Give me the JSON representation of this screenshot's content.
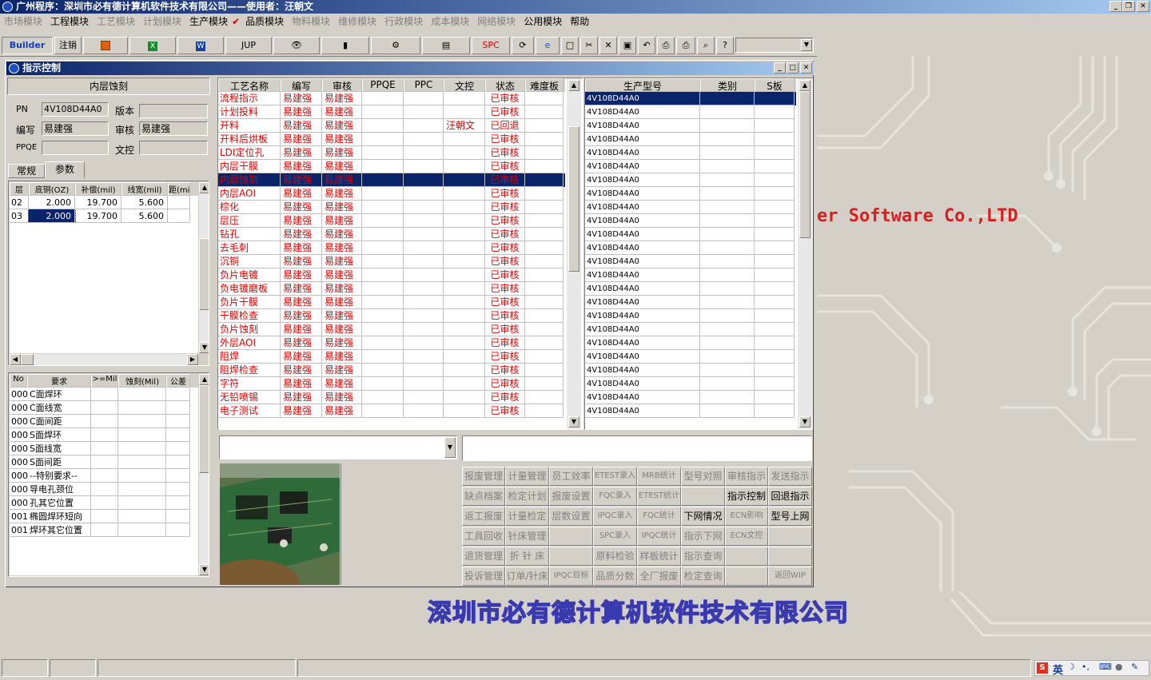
{
  "app": {
    "title": "广州程序：深圳市必有德计算机软件技术有限公司——使用者：汪朝文"
  },
  "menu": [
    {
      "label": "市场模块",
      "enabled": false
    },
    {
      "label": "工程模块",
      "enabled": true
    },
    {
      "label": "工艺模块",
      "enabled": false
    },
    {
      "label": "计划模块",
      "enabled": false
    },
    {
      "label": "生产模块",
      "enabled": true
    },
    {
      "label": "品质模块",
      "enabled": true
    },
    {
      "label": "物料模块",
      "enabled": false
    },
    {
      "label": "维修模块",
      "enabled": false
    },
    {
      "label": "行政模块",
      "enabled": false
    },
    {
      "label": "成本模块",
      "enabled": false
    },
    {
      "label": "网络模块",
      "enabled": false
    },
    {
      "label": "公用模块",
      "enabled": true
    },
    {
      "label": "帮助",
      "enabled": true
    }
  ],
  "toolbar": {
    "builder": "Builder",
    "logout": "注销",
    "jup": "JUP",
    "spc": "SPC"
  },
  "desktop": {
    "company_en": "er Software Co.,LTD",
    "company_cn": "深圳市必有德计算机软件技术有限公司"
  },
  "window": {
    "title": "指示控制",
    "step": "内层蚀刻",
    "pn_label": "PN",
    "pn_value": "4V108D44A0",
    "version_label": "版本",
    "version_value": "",
    "author_label": "编写",
    "author_value": "易建强",
    "review_label": "审核",
    "review_value": "易建强",
    "ppqe_label": "PPQE",
    "ppqe_value": "",
    "doc_label": "文控",
    "doc_value": "",
    "tabs": [
      "常规",
      "参数"
    ],
    "param_headers": [
      "层",
      "底铜(OZ)",
      "补偿(mil)",
      "线宽(mil)",
      "距(mi"
    ],
    "param_rows": [
      [
        "02",
        "2.000",
        "19.700",
        "5.600"
      ],
      [
        "03",
        "2.000",
        "19.700",
        "5.600"
      ]
    ],
    "req_headers": [
      "No",
      "要求",
      ">=Mil",
      "蚀刻(Mil)",
      "公差"
    ],
    "req_rows": [
      [
        "000",
        "C面焊环"
      ],
      [
        "000",
        "C面线宽"
      ],
      [
        "000",
        "C面间距"
      ],
      [
        "000",
        "S面焊环"
      ],
      [
        "000",
        "S面线宽"
      ],
      [
        "000",
        "S面间距"
      ],
      [
        "000",
        "--特别要求--"
      ],
      [
        "000",
        "导电孔颈位"
      ],
      [
        "000",
        "孔其它位置"
      ],
      [
        "001",
        "椭圆焊环短向"
      ],
      [
        "001",
        "焊环其它位置"
      ]
    ],
    "proc_headers": [
      "工艺名称",
      "编写",
      "审核",
      "PPQE",
      "PPC",
      "文控",
      "状态",
      "难度板"
    ],
    "proc_rows": [
      [
        "流程指示",
        "易建强",
        "易建强",
        "",
        "",
        "",
        "已审核"
      ],
      [
        "计划投料",
        "易建强",
        "易建强",
        "",
        "",
        "",
        "已审核"
      ],
      [
        "开料",
        "易建强",
        "易建强",
        "",
        "",
        "汪朝文",
        "已回退"
      ],
      [
        "开料后烘板",
        "易建强",
        "易建强",
        "",
        "",
        "",
        "已审核"
      ],
      [
        "LDI定位孔",
        "易建强",
        "易建强",
        "",
        "",
        "",
        "已审核"
      ],
      [
        "内层干膜",
        "易建强",
        "易建强",
        "",
        "",
        "",
        "已审核"
      ],
      [
        "内层蚀刻",
        "易建强",
        "易建强",
        "",
        "",
        "",
        "已审核"
      ],
      [
        "内层AOI",
        "易建强",
        "易建强",
        "",
        "",
        "",
        "已审核"
      ],
      [
        "棕化",
        "易建强",
        "易建强",
        "",
        "",
        "",
        "已审核"
      ],
      [
        "层压",
        "易建强",
        "易建强",
        "",
        "",
        "",
        "已审核"
      ],
      [
        "钻孔",
        "易建强",
        "易建强",
        "",
        "",
        "",
        "已审核"
      ],
      [
        "去毛刺",
        "易建强",
        "易建强",
        "",
        "",
        "",
        "已审核"
      ],
      [
        "沉铜",
        "易建强",
        "易建强",
        "",
        "",
        "",
        "已审核"
      ],
      [
        "负片电镀",
        "易建强",
        "易建强",
        "",
        "",
        "",
        "已审核"
      ],
      [
        "负电镀磨板",
        "易建强",
        "易建强",
        "",
        "",
        "",
        "已审核"
      ],
      [
        "负片干膜",
        "易建强",
        "易建强",
        "",
        "",
        "",
        "已审核"
      ],
      [
        "干膜检查",
        "易建强",
        "易建强",
        "",
        "",
        "",
        "已审核"
      ],
      [
        "负片蚀刻",
        "易建强",
        "易建强",
        "",
        "",
        "",
        "已审核"
      ],
      [
        "外层AOI",
        "易建强",
        "易建强",
        "",
        "",
        "",
        "已审核"
      ],
      [
        "阻焊",
        "易建强",
        "易建强",
        "",
        "",
        "",
        "已审核"
      ],
      [
        "阻焊检查",
        "易建强",
        "易建强",
        "",
        "",
        "",
        "已审核"
      ],
      [
        "字符",
        "易建强",
        "易建强",
        "",
        "",
        "",
        "已审核"
      ],
      [
        "无铅喷锡",
        "易建强",
        "易建强",
        "",
        "",
        "",
        "已审核"
      ],
      [
        "电子测试",
        "易建强",
        "易建强",
        "",
        "",
        "",
        "已审核"
      ]
    ],
    "model_headers": [
      "生产型号",
      "类别",
      "S板"
    ],
    "model_value": "4V108D44A0",
    "buttons": [
      [
        "报废管理",
        "计量管理",
        "员工效率",
        "ETEST录入",
        "MRB统计",
        "型号对照",
        "审核指示",
        "发送指示"
      ],
      [
        "缺点档案",
        "检定计划",
        "报废设置",
        "FQC录入",
        "ETEST统计",
        "",
        "指示控制",
        "回退指示"
      ],
      [
        "返工报废",
        "计量检定",
        "层数设置",
        "IPQC录入",
        "FQC统计",
        "下网情况",
        "ECN影响",
        "型号上网"
      ],
      [
        "工具回收",
        "针床管理",
        "",
        "SPC录入",
        "IPQC统计",
        "指示下网",
        "ECN文控",
        ""
      ],
      [
        "退货管理",
        "折 针 床",
        "",
        "原料检验",
        "样板统计",
        "指示查询",
        "",
        ""
      ],
      [
        "投诉管理",
        "订单/针床",
        "IPQC目标",
        "品质分数",
        "全厂报废",
        "检定查询",
        "",
        "返回WIP"
      ]
    ],
    "buttons_enabled": [
      [
        0,
        0,
        0,
        0,
        0,
        0,
        0,
        0
      ],
      [
        0,
        0,
        0,
        0,
        0,
        0,
        1,
        1
      ],
      [
        0,
        0,
        0,
        0,
        0,
        1,
        0,
        1
      ],
      [
        0,
        0,
        0,
        0,
        0,
        0,
        0,
        0
      ],
      [
        0,
        0,
        0,
        0,
        0,
        0,
        0,
        0
      ],
      [
        0,
        0,
        0,
        0,
        0,
        0,
        0,
        0
      ]
    ]
  },
  "tray": {
    "ime": "英"
  }
}
